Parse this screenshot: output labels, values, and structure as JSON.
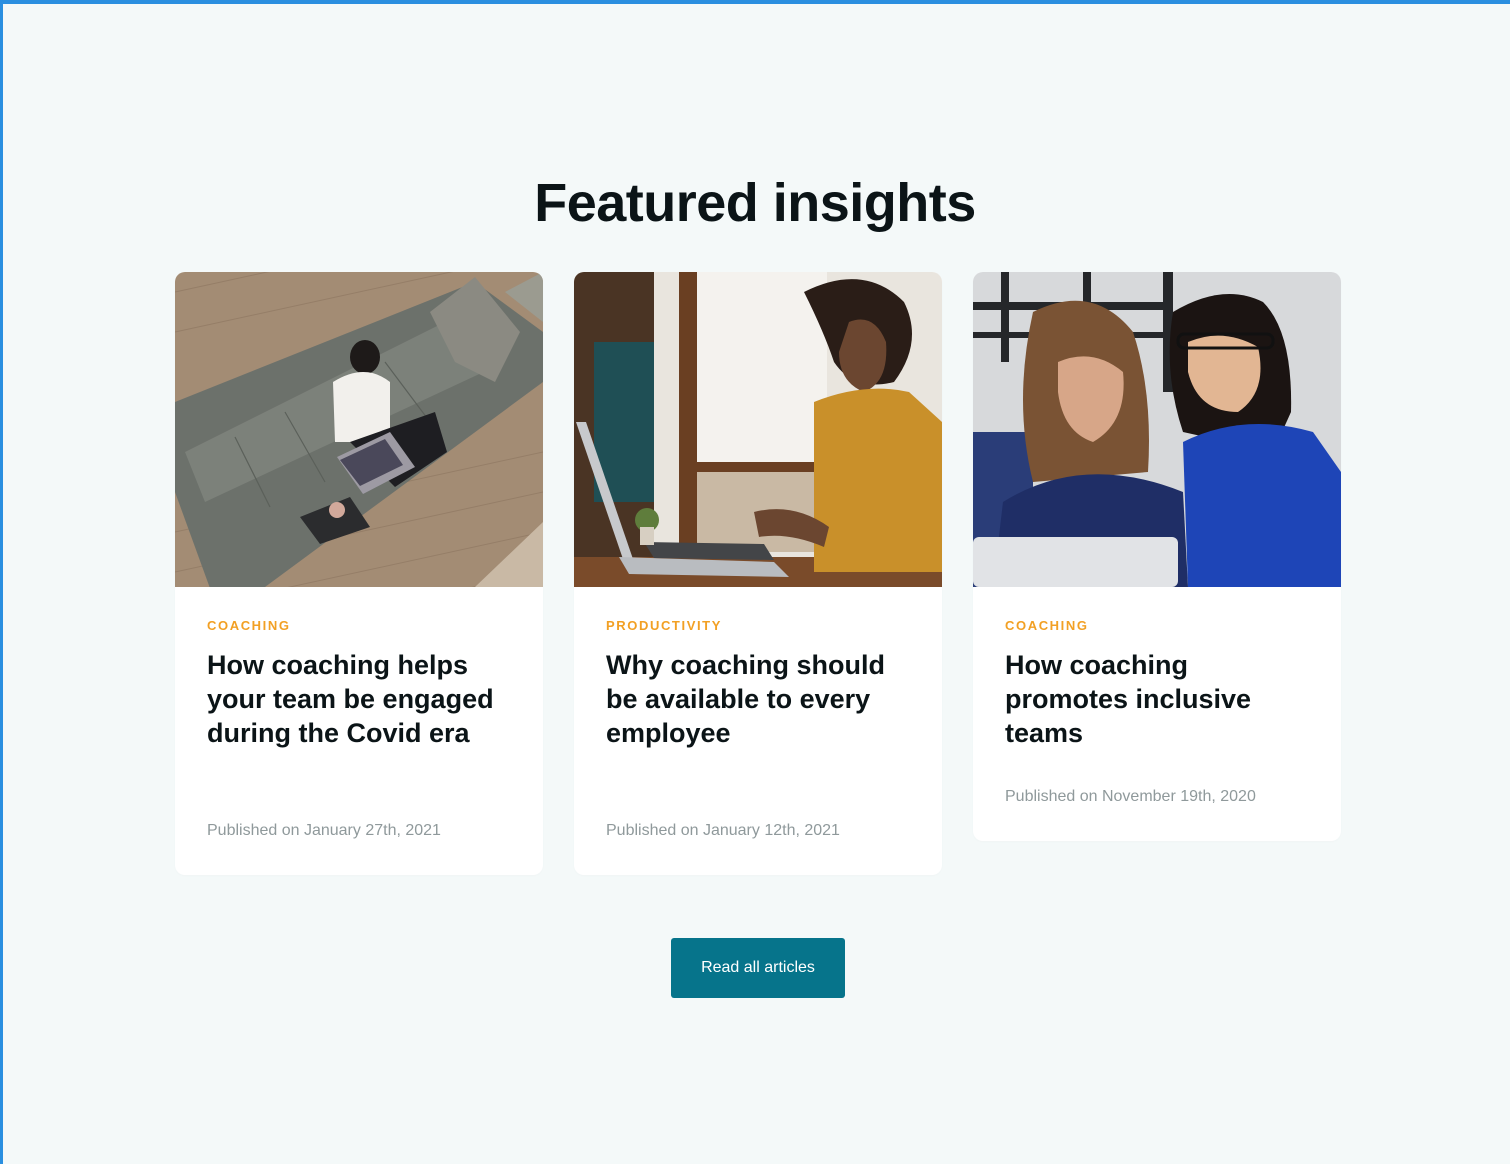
{
  "section": {
    "title": "Featured insights"
  },
  "articles": [
    {
      "category": "COACHING",
      "title": "How coaching helps your team be engaged during the Covid era",
      "date": "Published on January 27th, 2021",
      "image": "woman-on-sofa-with-laptop"
    },
    {
      "category": "PRODUCTIVITY",
      "title": "Why coaching should be available to every employee",
      "date": "Published on January 12th, 2021",
      "image": "woman-smiling-typing-on-laptop"
    },
    {
      "category": "COACHING",
      "title": "How coaching promotes inclusive teams",
      "date": "Published on November 19th, 2020",
      "image": "two-women-looking-at-laptop"
    }
  ],
  "cta": {
    "label": "Read all articles"
  },
  "colors": {
    "background": "#f4f9f9",
    "accent": "#f2a024",
    "button": "#06748b",
    "frame": "#2a8fe0"
  }
}
